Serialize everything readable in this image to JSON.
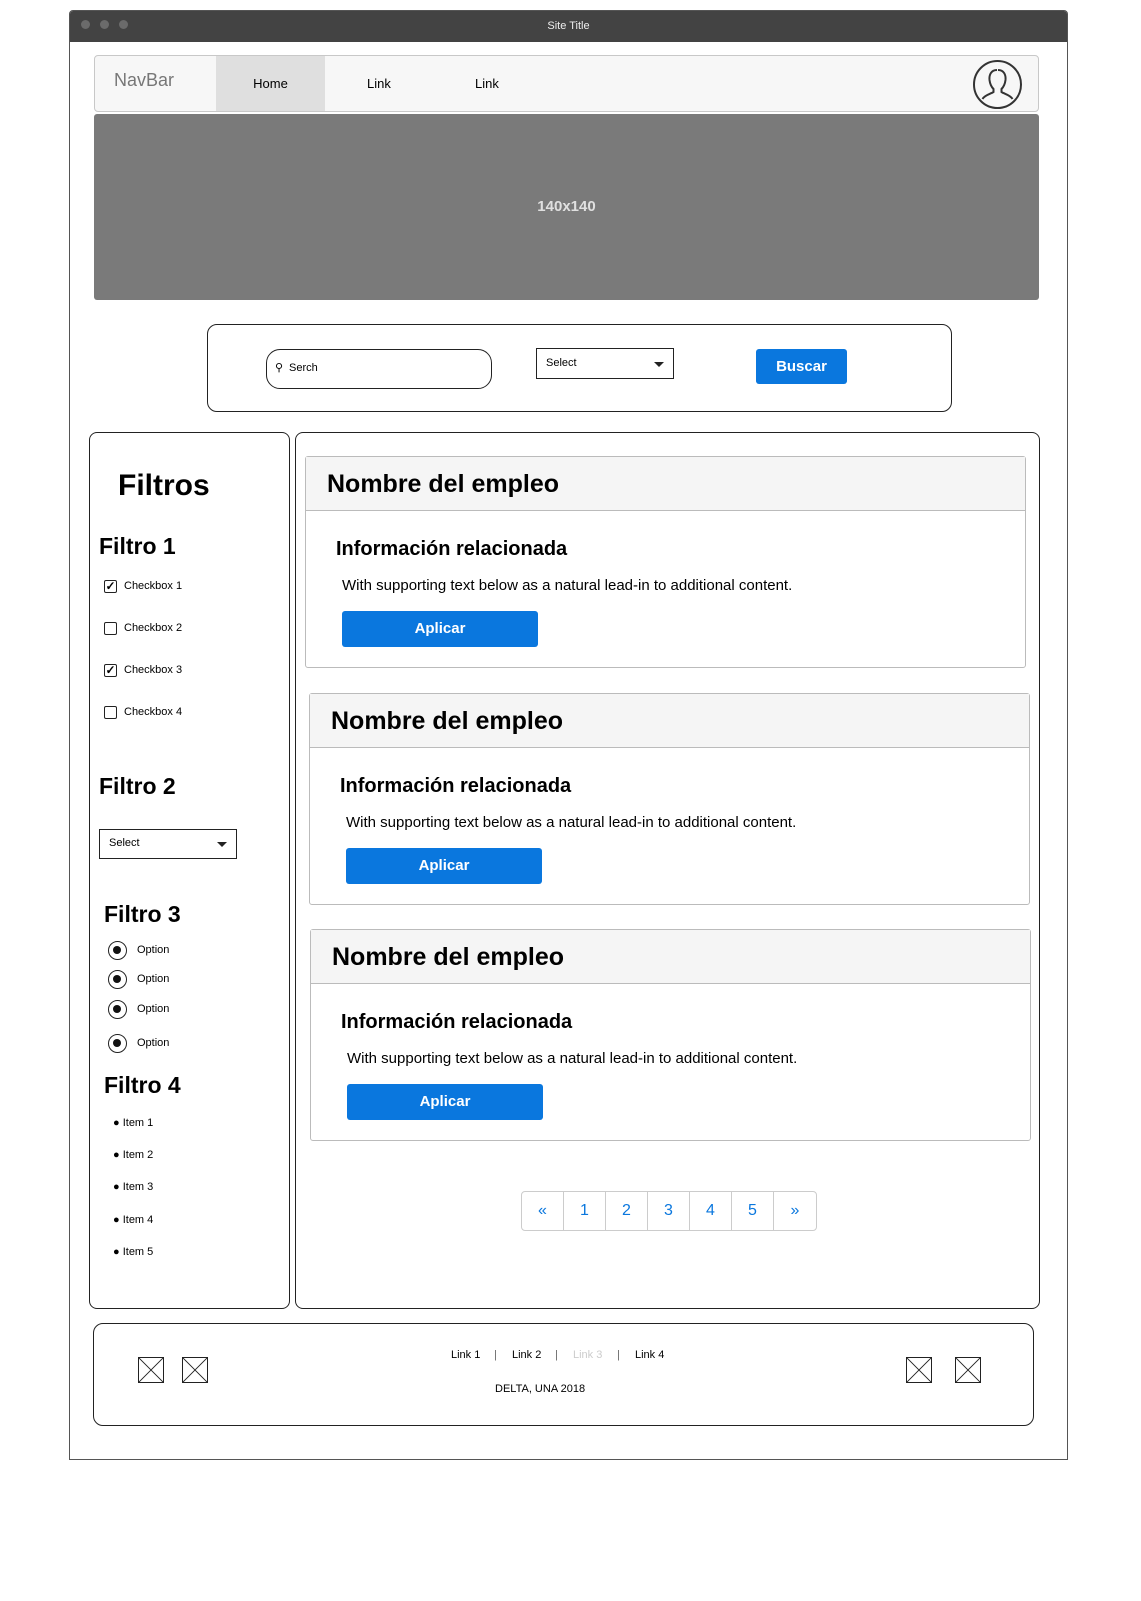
{
  "window": {
    "title": "Site Title"
  },
  "navbar": {
    "brand": "NavBar",
    "items": [
      "Home",
      "Link",
      "Link"
    ]
  },
  "hero": {
    "label": "140x140"
  },
  "search": {
    "placeholder": "Serch",
    "select": "Select",
    "button": "Buscar"
  },
  "filters": {
    "title": "Filtros",
    "filtro1": {
      "title": "Filtro 1",
      "checkboxes": [
        {
          "label": "Checkbox 1",
          "checked": true
        },
        {
          "label": "Checkbox 2",
          "checked": false
        },
        {
          "label": "Checkbox 3",
          "checked": true
        },
        {
          "label": "Checkbox 4",
          "checked": false
        }
      ]
    },
    "filtro2": {
      "title": "Filtro 2",
      "select": "Select"
    },
    "filtro3": {
      "title": "Filtro 3",
      "options": [
        "Option",
        "Option",
        "Option",
        "Option"
      ]
    },
    "filtro4": {
      "title": "Filtro 4",
      "items": [
        "Item 1",
        "Item 2",
        "Item 3",
        "Item 4",
        "Item 5"
      ]
    }
  },
  "jobs": [
    {
      "title": "Nombre del empleo",
      "subtitle": "Información relacionada",
      "text": "With supporting text below as a natural lead-in to additional content.",
      "button": "Aplicar"
    },
    {
      "title": "Nombre del empleo",
      "subtitle": "Información relacionada",
      "text": "With supporting text below as a natural lead-in to additional content.",
      "button": "Aplicar"
    },
    {
      "title": "Nombre del empleo",
      "subtitle": "Información relacionada",
      "text": "With supporting text below as a natural lead-in to additional content.",
      "button": "Aplicar"
    }
  ],
  "pagination": [
    "«",
    "1",
    "2",
    "3",
    "4",
    "5",
    "»"
  ],
  "footer": {
    "links": [
      "Link 1",
      "Link 2",
      "Link 3",
      "Link 4"
    ],
    "separator": "|",
    "copyright": "DELTA, UNA 2018"
  }
}
